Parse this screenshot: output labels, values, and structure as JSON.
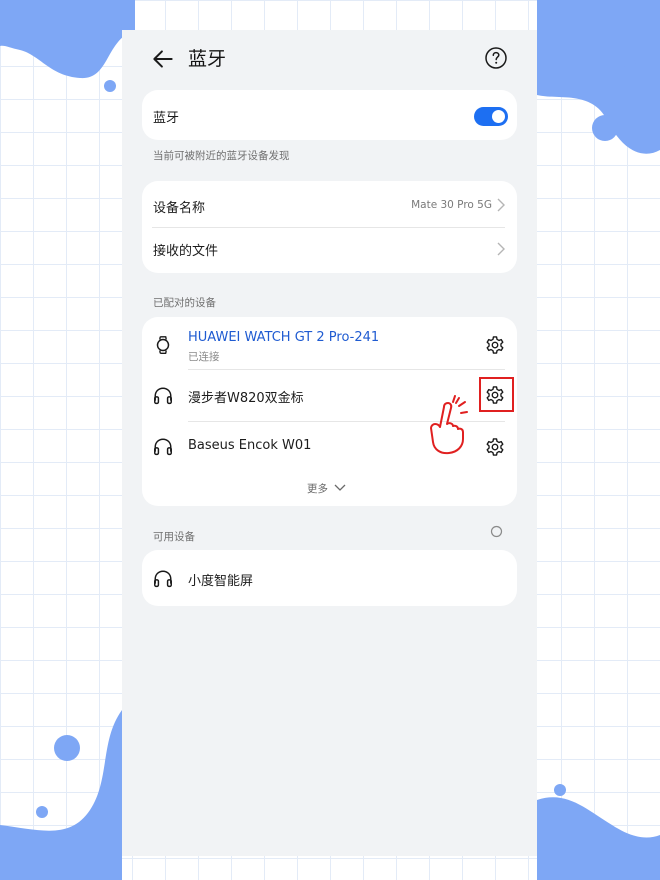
{
  "header": {
    "title": "蓝牙"
  },
  "bluetooth": {
    "label": "蓝牙",
    "enabled": true,
    "discoverable_text": "当前可被附近的蓝牙设备发现"
  },
  "device_info": {
    "name_label": "设备名称",
    "name_value": "Mate 30 Pro 5G",
    "received_files_label": "接收的文件"
  },
  "paired": {
    "section_title": "已配对的设备",
    "devices": [
      {
        "name": "HUAWEI WATCH GT 2 Pro-241",
        "status": "已连接",
        "icon": "watch-icon"
      },
      {
        "name": "漫步者W820双金标",
        "status": "",
        "icon": "headphones-icon"
      },
      {
        "name": "Baseus Encok W01",
        "status": "",
        "icon": "headphones-icon"
      }
    ],
    "more_label": "更多"
  },
  "available": {
    "section_title": "可用设备",
    "devices": [
      {
        "name": "小度智能屏",
        "icon": "headphones-icon"
      }
    ]
  },
  "colors": {
    "accent": "#1d6ff2",
    "connected_text": "#1f5bd1",
    "background_blue": "#7ea7f5",
    "highlight_red": "#e02020"
  }
}
